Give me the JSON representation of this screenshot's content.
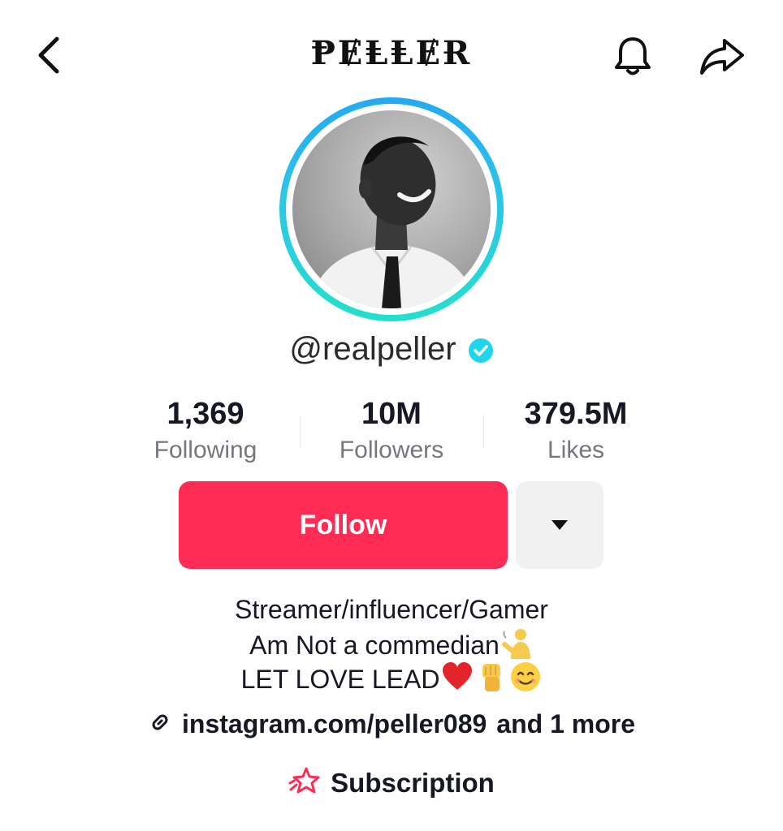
{
  "header": {
    "title": "ⱣɆⱠⱠɆɌ",
    "icons": {
      "back": "chevron-left-icon",
      "notifications": "bell-icon",
      "share": "share-arrow-icon"
    }
  },
  "profile": {
    "username": "@realpeller",
    "verified": true,
    "ring_colors": [
      "#25a9f2",
      "#23e0cc"
    ]
  },
  "stats": [
    {
      "value": "1,369",
      "label": "Following"
    },
    {
      "value": "10M",
      "label": "Followers"
    },
    {
      "value": "379.5M",
      "label": "Likes"
    }
  ],
  "actions": {
    "follow_label": "Follow",
    "follow_color": "#fe2c55",
    "more_icon": "caret-down-icon"
  },
  "bio": {
    "lines": [
      "Streamer/influencer/Gamer",
      "Am Not a commedian",
      "LET LOVE LEAD"
    ],
    "emojis": [
      "person-gesturing-icon",
      "red-heart-icon",
      "raised-fist-icon",
      "smiling-face-icon"
    ]
  },
  "link": {
    "url": "instagram.com/peller089",
    "more": "and 1 more",
    "icon": "link-icon"
  },
  "subscription": {
    "label": "Subscription",
    "icon": "subscription-star-icon",
    "icon_color": "#fe2c55"
  }
}
